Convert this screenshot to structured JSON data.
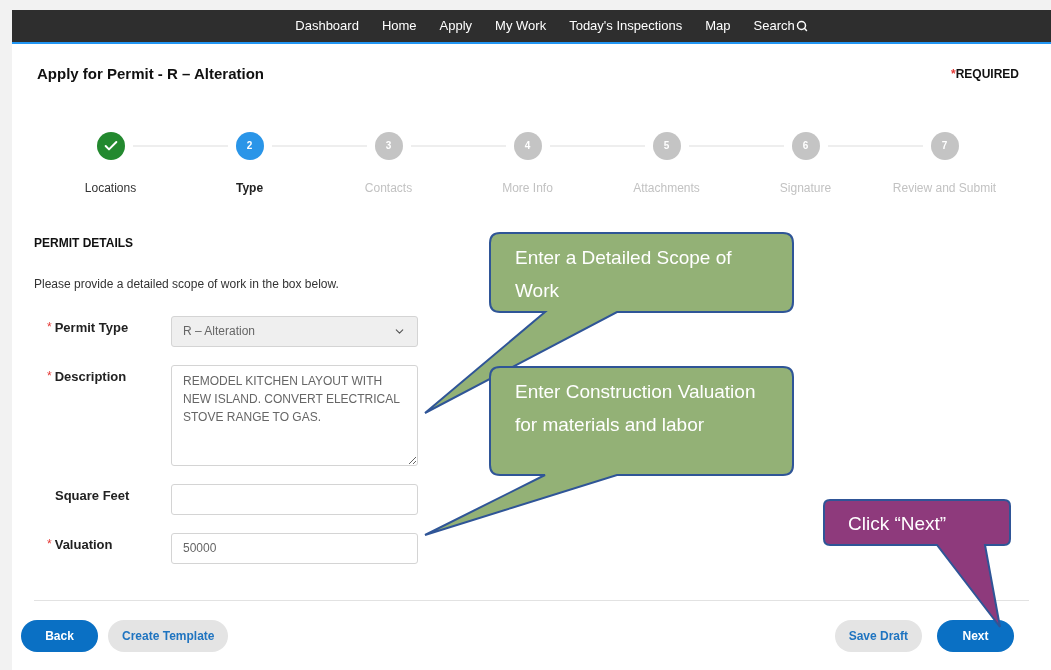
{
  "nav": {
    "items": [
      "Dashboard",
      "Home",
      "Apply",
      "My Work",
      "Today's Inspections",
      "Map",
      "Search"
    ]
  },
  "page": {
    "title": "Apply for Permit - R – Alteration",
    "required_mark": "*",
    "required_text": "REQUIRED"
  },
  "steps": [
    {
      "label": "Locations",
      "kind": "done"
    },
    {
      "label": "Type",
      "number": "2",
      "kind": "current"
    },
    {
      "label": "Contacts",
      "number": "3",
      "kind": "pending"
    },
    {
      "label": "More Info",
      "number": "4",
      "kind": "pending"
    },
    {
      "label": "Attachments",
      "number": "5",
      "kind": "pending"
    },
    {
      "label": "Signature",
      "number": "6",
      "kind": "pending"
    },
    {
      "label": "Review and Submit",
      "number": "7",
      "kind": "pending"
    }
  ],
  "section": {
    "heading": "PERMIT DETAILS",
    "instruction": "Please provide a detailed scope of work in the box below."
  },
  "fields": [
    {
      "label": "Permit Type",
      "kind": "select",
      "required": true,
      "value": "R – Alteration",
      "disabled": true
    },
    {
      "label": "Description",
      "kind": "textarea",
      "required": true,
      "value": "REMODEL KITCHEN LAYOUT WITH NEW ISLAND. CONVERT ELECTRICAL STOVE RANGE TO GAS."
    },
    {
      "label": "Square Feet",
      "kind": "text",
      "required": false
    },
    {
      "label": "Valuation",
      "kind": "text",
      "required": true,
      "value": "50000"
    }
  ],
  "buttons_left": [
    {
      "label": "Back",
      "kind": "primary"
    },
    {
      "label": "Create Template",
      "kind": "secondary"
    }
  ],
  "buttons_right": [
    {
      "label": "Save Draft",
      "kind": "secondary"
    },
    {
      "label": "Next",
      "kind": "primary"
    }
  ],
  "callouts": [
    {
      "text": "Enter a Detailed Scope of Work",
      "color": "#93b176"
    },
    {
      "text": "Enter Construction Valuation for materials and labor",
      "color": "#93b176"
    },
    {
      "text": "Click “Next”",
      "color": "#8e3a7c"
    }
  ]
}
